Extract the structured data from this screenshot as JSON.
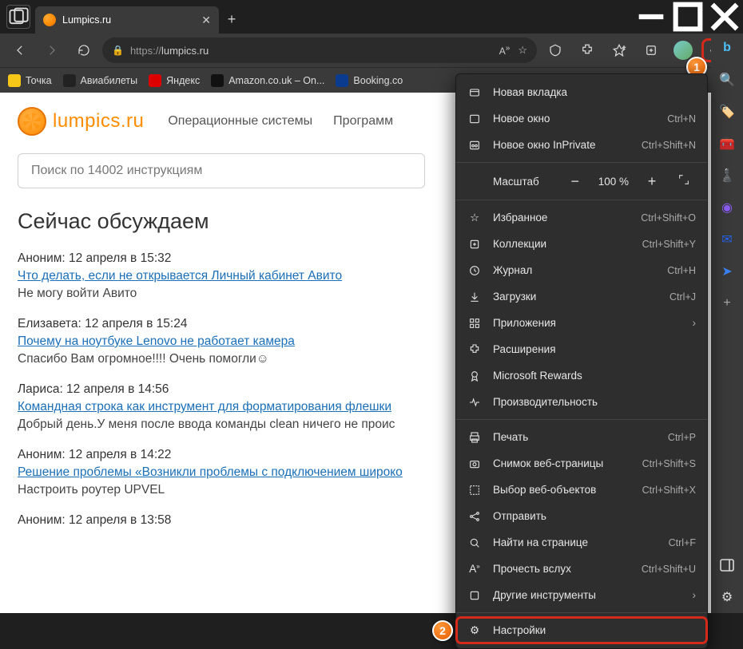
{
  "window": {
    "tab_title": "Lumpics.ru"
  },
  "toolbar": {
    "url_proto": "https://",
    "url_host": "lumpics.ru"
  },
  "bookmarks": [
    {
      "label": "Точка",
      "color": "#f5c518"
    },
    {
      "label": "Авиабилеты",
      "color": "#222"
    },
    {
      "label": "Яндекс",
      "color": "#d00"
    },
    {
      "label": "Amazon.co.uk – On...",
      "color": "#111"
    },
    {
      "label": "Booking.co",
      "color": "#0a3b8f"
    }
  ],
  "page": {
    "brand": "lumpics.ru",
    "nav": [
      "Операционные системы",
      "Программ"
    ],
    "search_placeholder": "Поиск по 14002 инструкциям",
    "heading": "Сейчас обсуждаем",
    "discussions": [
      {
        "meta": "Аноним: 12 апреля в 15:32",
        "link": "Что делать, если не открывается Личный кабинет Авито",
        "excerpt": "Не могу войти Авито"
      },
      {
        "meta": "Елизавета: 12 апреля в 15:24",
        "link": "Почему на ноутбуке Lenovo не работает камера",
        "excerpt": "Спасибо Вам огромное!!!! Очень помогли☺"
      },
      {
        "meta": "Лариса: 12 апреля в 14:56",
        "link": "Командная строка как инструмент для форматирования флешки",
        "excerpt": "Добрый день.У меня после ввода команды clean ничего не проис"
      },
      {
        "meta": "Аноним: 12 апреля в 14:22",
        "link": "Решение проблемы «Возникли проблемы с подключением широко",
        "excerpt": "Настроить роутер UPVEL"
      },
      {
        "meta": "Аноним: 12 апреля в 13:58",
        "link": "",
        "excerpt": ""
      }
    ]
  },
  "menu": {
    "new_tab": "Новая вкладка",
    "new_window": "Новое окно",
    "new_window_sc": "Ctrl+N",
    "inprivate": "Новое окно InPrivate",
    "inprivate_sc": "Ctrl+Shift+N",
    "zoom_label": "Масштаб",
    "zoom_value": "100 %",
    "favorites": "Избранное",
    "favorites_sc": "Ctrl+Shift+O",
    "collections": "Коллекции",
    "collections_sc": "Ctrl+Shift+Y",
    "history": "Журнал",
    "history_sc": "Ctrl+H",
    "downloads": "Загрузки",
    "downloads_sc": "Ctrl+J",
    "apps": "Приложения",
    "extensions": "Расширения",
    "rewards": "Microsoft Rewards",
    "performance": "Производительность",
    "print": "Печать",
    "print_sc": "Ctrl+P",
    "screenshot": "Снимок веб-страницы",
    "screenshot_sc": "Ctrl+Shift+S",
    "webselect": "Выбор веб-объектов",
    "webselect_sc": "Ctrl+Shift+X",
    "share": "Отправить",
    "find": "Найти на странице",
    "find_sc": "Ctrl+F",
    "readaloud": "Прочесть вслух",
    "readaloud_sc": "Ctrl+Shift+U",
    "moretools": "Другие инструменты",
    "settings": "Настройки"
  },
  "callouts": {
    "one": "1",
    "two": "2"
  }
}
